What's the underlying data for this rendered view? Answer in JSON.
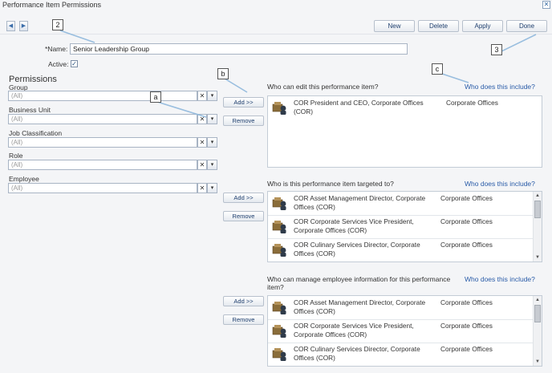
{
  "window": {
    "title": "Performance Item Permissions",
    "close_icon": "close-icon"
  },
  "nav": {
    "prev_icon": "◀",
    "next_icon": "▶"
  },
  "toolbar": {
    "new": "New",
    "delete": "Delete",
    "apply": "Apply",
    "done": "Done"
  },
  "form": {
    "name_label": "*Name:",
    "name_value": "Senior Leadership Group",
    "active_label": "Active:",
    "active_checked": true
  },
  "permissions": {
    "title": "Permissions",
    "filters": [
      {
        "label": "Group",
        "placeholder": "(All)"
      },
      {
        "label": "Business Unit",
        "placeholder": "(All)"
      },
      {
        "label": "Job Classification",
        "placeholder": "(All)"
      },
      {
        "label": "Role",
        "placeholder": "(All)"
      },
      {
        "label": "Employee",
        "placeholder": "(All)"
      }
    ],
    "add_label": "Add >>",
    "remove_label": "Remove"
  },
  "sections": [
    {
      "title": "Who can edit this performance item?",
      "link": "Who does this include?",
      "items": [
        {
          "name": "COR President and CEO, Corporate Offices (COR)",
          "location": "Corporate Offices"
        }
      ]
    },
    {
      "title": "Who is this performance item targeted to?",
      "link": "Who does this include?",
      "items": [
        {
          "name": "COR Asset Management Director, Corporate Offices (COR)",
          "location": "Corporate Offices"
        },
        {
          "name": "COR Corporate Services Vice President, Corporate Offices (COR)",
          "location": "Corporate Offices"
        },
        {
          "name": "COR Culinary Services Director, Corporate Offices (COR)",
          "location": "Corporate Offices"
        }
      ]
    },
    {
      "title": "Who can manage employee information for this performance item?",
      "link": "Who does this include?",
      "items": [
        {
          "name": "COR Asset Management Director, Corporate Offices (COR)",
          "location": "Corporate Offices"
        },
        {
          "name": "COR Corporate Services Vice President, Corporate Offices (COR)",
          "location": "Corporate Offices"
        },
        {
          "name": "COR Culinary Services Director, Corporate Offices (COR)",
          "location": "Corporate Offices"
        }
      ]
    }
  ],
  "callouts": {
    "two": "2",
    "three": "3",
    "a": "a",
    "b": "b",
    "c": "c"
  }
}
